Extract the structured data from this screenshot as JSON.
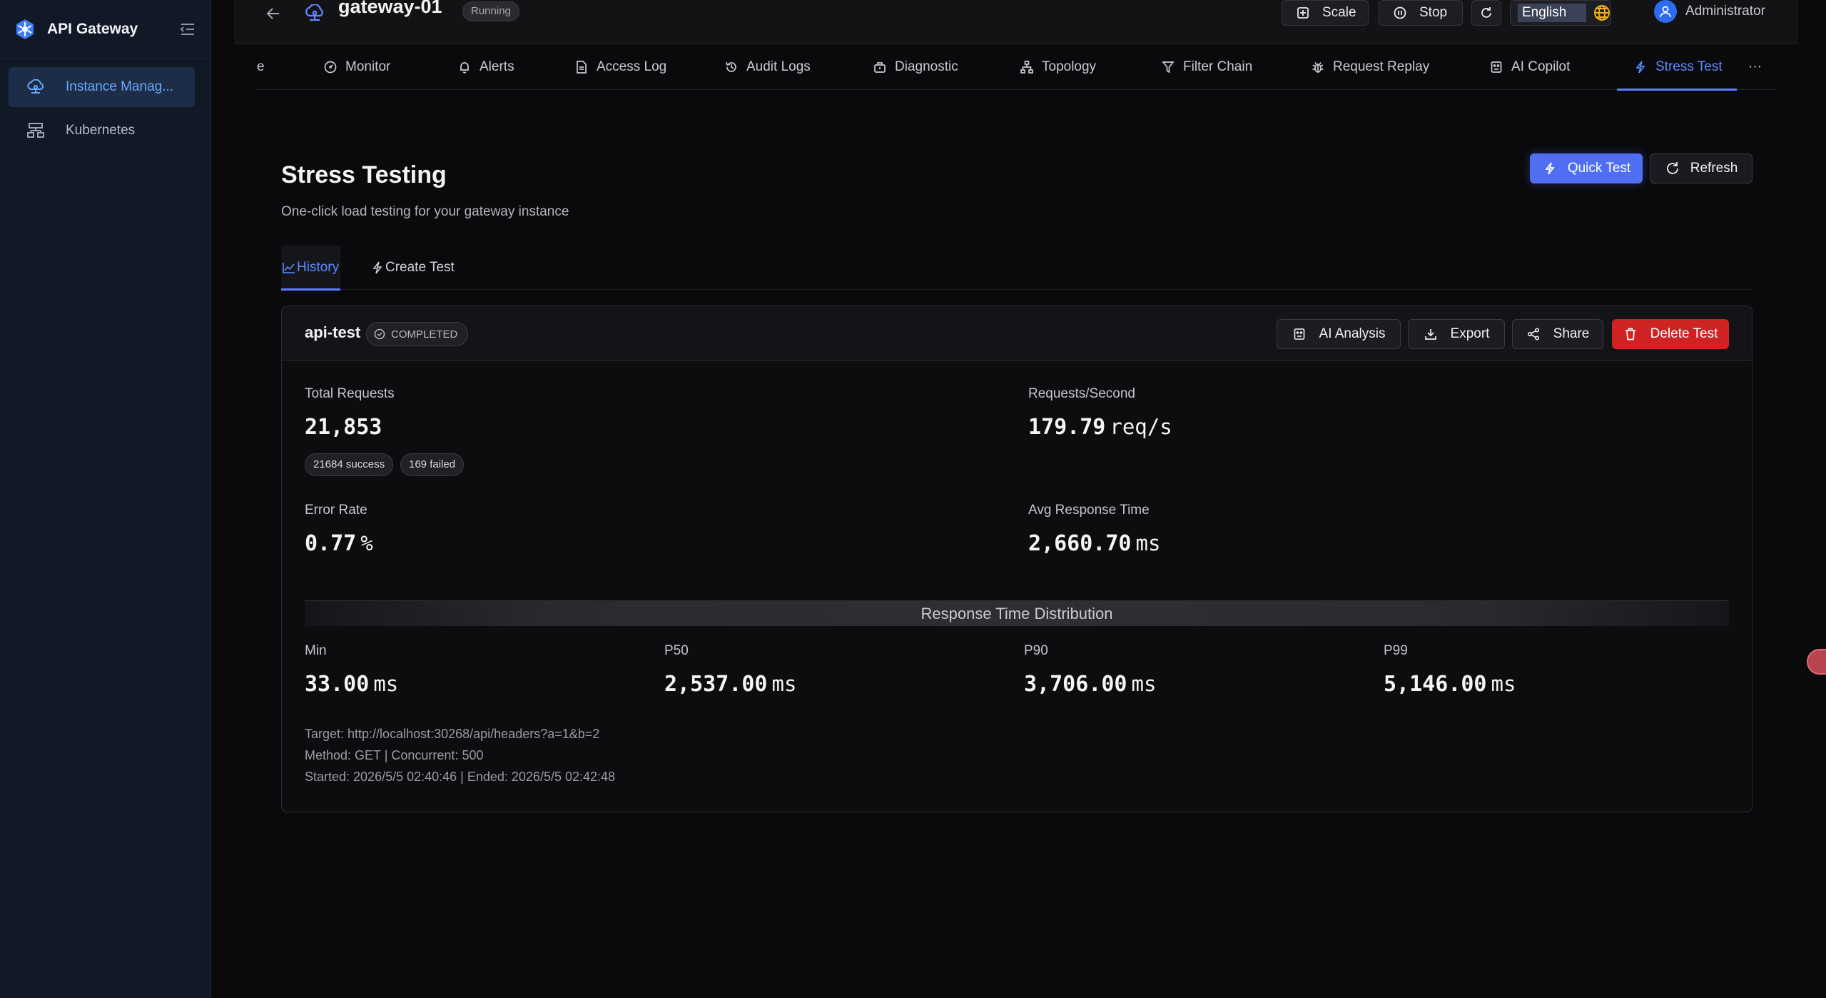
{
  "app": {
    "title": "API Gateway"
  },
  "sidebar": {
    "items": [
      {
        "label": "Instance Manag...",
        "icon": "cloud-network-icon",
        "active": true
      },
      {
        "label": "Kubernetes",
        "icon": "cluster-icon",
        "active": false
      }
    ]
  },
  "header": {
    "gateway_name": "gateway-01",
    "status": "Running",
    "scale_label": "Scale",
    "stop_label": "Stop",
    "language": "English",
    "user": "Administrator"
  },
  "tabs": [
    {
      "label": "e",
      "icon": ""
    },
    {
      "label": "Monitor",
      "icon": "gauge-icon"
    },
    {
      "label": "Alerts",
      "icon": "bell-icon"
    },
    {
      "label": "Access Log",
      "icon": "document-icon"
    },
    {
      "label": "Audit Logs",
      "icon": "history-icon"
    },
    {
      "label": "Diagnostic",
      "icon": "toolbox-icon"
    },
    {
      "label": "Topology",
      "icon": "topology-icon"
    },
    {
      "label": "Filter Chain",
      "icon": "filter-icon"
    },
    {
      "label": "Request Replay",
      "icon": "bug-icon"
    },
    {
      "label": "AI Copilot",
      "icon": "robot-icon"
    },
    {
      "label": "Stress Test",
      "icon": "bolt-icon",
      "active": true
    },
    {
      "label": "···",
      "icon": ""
    }
  ],
  "page": {
    "title": "Stress Testing",
    "subtitle": "One-click load testing for your gateway instance",
    "quick_test_label": "Quick Test",
    "refresh_label": "Refresh"
  },
  "subtabs": {
    "history": "History",
    "create": "Create Test"
  },
  "test": {
    "name": "api-test",
    "status": "COMPLETED",
    "ai_analysis_label": "AI Analysis",
    "export_label": "Export",
    "share_label": "Share",
    "delete_label": "Delete Test",
    "total_requests_label": "Total Requests",
    "total_requests": "21,853",
    "success_chip": "21684 success",
    "failed_chip": "169 failed",
    "rps_label": "Requests/Second",
    "rps_value": "179.79",
    "rps_unit": "req/s",
    "error_rate_label": "Error Rate",
    "error_rate_value": "0.77",
    "error_rate_unit": "%",
    "avg_rt_label": "Avg Response Time",
    "avg_rt_value": "2,660.70",
    "avg_rt_unit": "ms",
    "distribution_title": "Response Time Distribution",
    "percentiles": [
      {
        "label": "Min",
        "value": "33.00",
        "unit": "ms"
      },
      {
        "label": "P50",
        "value": "2,537.00",
        "unit": "ms"
      },
      {
        "label": "P90",
        "value": "3,706.00",
        "unit": "ms"
      },
      {
        "label": "P99",
        "value": "5,146.00",
        "unit": "ms"
      }
    ],
    "target_line": "Target: http://localhost:30268/api/headers?a=1&b=2",
    "method_line": "Method: GET | Concurrent: 500",
    "time_line": "Started: 2026/5/5 02:40:46 | Ended: 2026/5/5 02:42:48"
  },
  "colors": {
    "accent": "#5d7dff",
    "primary_button": "#4f6ef2",
    "danger": "#cf2323",
    "sidebar_bg": "#111826"
  }
}
